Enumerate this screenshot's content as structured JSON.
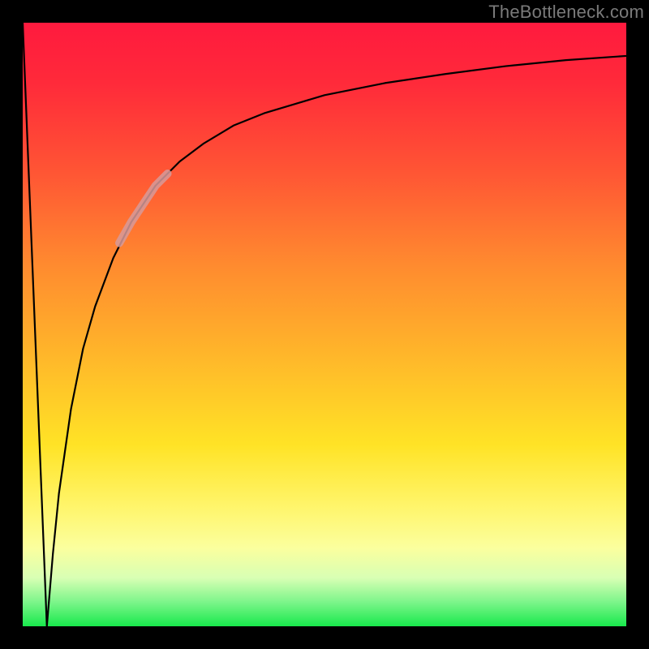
{
  "watermark": "TheBottleneck.com",
  "colors": {
    "frame": "#000000",
    "gradient_top": "#ff1a3e",
    "gradient_bottom": "#18e94c",
    "curve_stroke": "#000000",
    "highlight_stroke": "#d79a9a"
  },
  "chart_data": {
    "type": "line",
    "title": "",
    "xlabel": "",
    "ylabel": "",
    "xlim": [
      0,
      100
    ],
    "ylim": [
      0,
      100
    ],
    "grid": false,
    "legend": false,
    "note": "Bottleneck-style curve: y≈100 at x=0, drops to y≈0 near x≈4, then rises asymptotically toward y≈95 as x→100. Highlighted band along the rising limb roughly at x∈[16,24].",
    "series": [
      {
        "name": "curve-descending",
        "x": [
          0,
          1,
          2,
          3,
          4
        ],
        "values": [
          100,
          75,
          50,
          25,
          0
        ]
      },
      {
        "name": "curve-ascending",
        "x": [
          4,
          5,
          6,
          8,
          10,
          12,
          15,
          18,
          22,
          26,
          30,
          35,
          40,
          50,
          60,
          70,
          80,
          90,
          100
        ],
        "values": [
          0,
          12,
          22,
          36,
          46,
          53,
          61,
          67,
          73,
          77,
          80,
          83,
          85,
          88,
          90,
          91.5,
          92.8,
          93.8,
          94.5
        ]
      },
      {
        "name": "highlight-segment",
        "x": [
          16,
          18,
          20,
          22,
          24
        ],
        "values": [
          63.5,
          67,
          70,
          73,
          75
        ]
      }
    ]
  }
}
